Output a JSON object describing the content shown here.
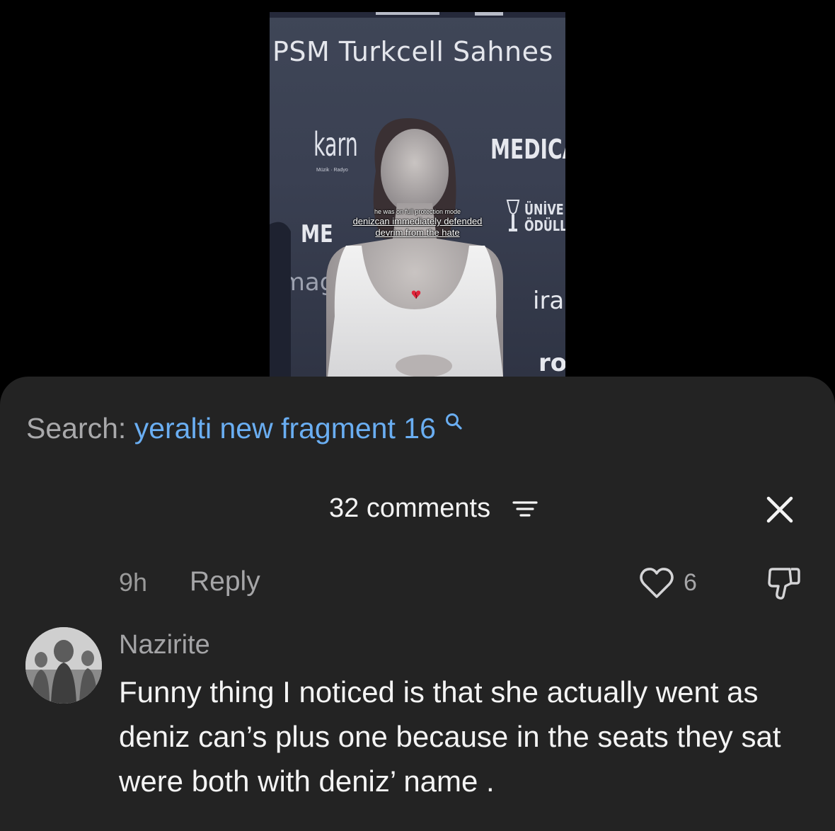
{
  "video": {
    "venue_sign": "PSM Turkcell Sahnes",
    "sponsor_left": "karn",
    "sponsor_left_sub": "Müzik · Radyo",
    "sponsor_right": "MEDICA",
    "award_text": "ÜNİVE\nÖDÜLL",
    "left_edge_text": "ME",
    "left_bottom_text": "omag",
    "right_text_1": "ira",
    "right_text_2": "rot",
    "caption_line_1": "he was on full protection mode",
    "caption_line_2": "denizcan immediately defended",
    "caption_line_3": "devrim from the hate",
    "heart_emoji": "broken-heart-icon"
  },
  "search": {
    "label": "Search:",
    "query": "yeralti new fragment 16"
  },
  "comments_header": {
    "count_label": "32 comments",
    "sort_icon": "sort-icon",
    "close_icon": "close-icon"
  },
  "previous_comment_actions": {
    "time": "9h",
    "reply_label": "Reply",
    "like_count": "6"
  },
  "comment": {
    "username": "Nazirite",
    "text": "Funny thing I noticed is that she actually went as deniz can’s plus one because in the seats they sat were both with deniz’ name ."
  },
  "colors": {
    "sheet_bg": "#232323",
    "search_query": "#6aaef2",
    "text_primary": "#f4f4f4",
    "text_secondary": "#a6a6a8"
  }
}
